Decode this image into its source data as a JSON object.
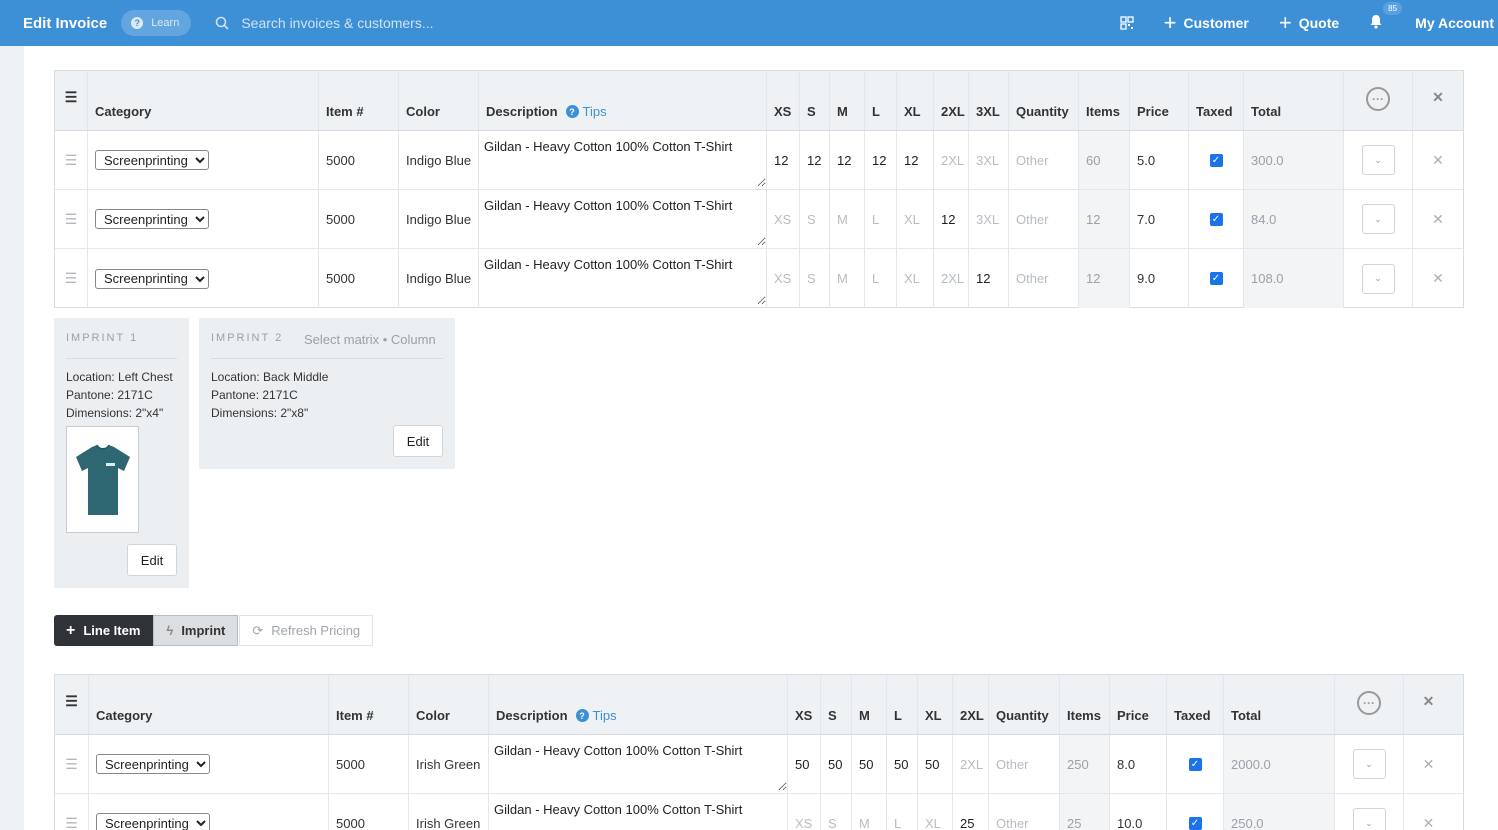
{
  "topbar": {
    "title": "Edit Invoice",
    "learn_label": "Learn",
    "search_placeholder": "Search invoices & customers...",
    "customer_label": "Customer",
    "quote_label": "Quote",
    "notification_count": "85",
    "account_label": "My Account"
  },
  "table_headers": {
    "category": "Category",
    "item": "Item #",
    "color": "Color",
    "description": "Description",
    "tips": "Tips",
    "quantity": "Quantity",
    "items": "Items",
    "price": "Price",
    "taxed": "Taxed",
    "total": "Total"
  },
  "group1": {
    "sizes": [
      "XS",
      "S",
      "M",
      "L",
      "XL",
      "2XL",
      "3XL"
    ],
    "rows": [
      {
        "category": "Screenprinting",
        "item": "5000",
        "color": "Indigo Blue",
        "description": "Gildan - Heavy Cotton 100% Cotton T-Shirt",
        "sizes": [
          "12",
          "12",
          "12",
          "12",
          "12",
          "",
          ""
        ],
        "quantity": "",
        "items": "60",
        "price": "5.0",
        "taxed": true,
        "total": "300.0"
      },
      {
        "category": "Screenprinting",
        "item": "5000",
        "color": "Indigo Blue",
        "description": "Gildan - Heavy Cotton 100% Cotton T-Shirt",
        "sizes": [
          "",
          "",
          "",
          "",
          "",
          "12",
          ""
        ],
        "quantity": "",
        "items": "12",
        "price": "7.0",
        "taxed": true,
        "total": "84.0"
      },
      {
        "category": "Screenprinting",
        "item": "5000",
        "color": "Indigo Blue",
        "description": "Gildan - Heavy Cotton 100% Cotton T-Shirt",
        "sizes": [
          "",
          "",
          "",
          "",
          "",
          "",
          "12"
        ],
        "quantity": "",
        "items": "12",
        "price": "9.0",
        "taxed": true,
        "total": "108.0"
      }
    ]
  },
  "quantity_placeholder": "Other",
  "imprints": [
    {
      "title": "IMPRINT 1",
      "subtitle": "",
      "location": "Location: Left Chest",
      "pantone": "Pantone: 2171C",
      "dimensions": "Dimensions: 2\"x4\"",
      "edit_label": "Edit"
    },
    {
      "title": "IMPRINT 2",
      "subtitle": "Select matrix • Column",
      "location": "Location: Back Middle",
      "pantone": "Pantone: 2171C",
      "dimensions": "Dimensions: 2\"x8\"",
      "edit_label": "Edit"
    }
  ],
  "actions": {
    "line_item": "Line Item",
    "imprint": "Imprint",
    "refresh": "Refresh Pricing"
  },
  "group2": {
    "sizes": [
      "XS",
      "S",
      "M",
      "L",
      "XL",
      "2XL"
    ],
    "rows": [
      {
        "category": "Screenprinting",
        "item": "5000",
        "color": "Irish Green",
        "description": "Gildan - Heavy Cotton 100% Cotton T-Shirt",
        "sizes": [
          "50",
          "50",
          "50",
          "50",
          "50",
          ""
        ],
        "quantity": "",
        "items": "250",
        "price": "8.0",
        "taxed": true,
        "total": "2000.0"
      },
      {
        "category": "Screenprinting",
        "item": "5000",
        "color": "Irish Green",
        "description": "Gildan - Heavy Cotton 100% Cotton T-Shirt",
        "sizes": [
          "",
          "",
          "",
          "",
          "",
          "25"
        ],
        "quantity": "",
        "items": "25",
        "price": "10.0",
        "taxed": true,
        "total": "250.0"
      }
    ]
  },
  "colors": {
    "topbar": "#3d8fd6",
    "accent": "#1a73e8"
  }
}
